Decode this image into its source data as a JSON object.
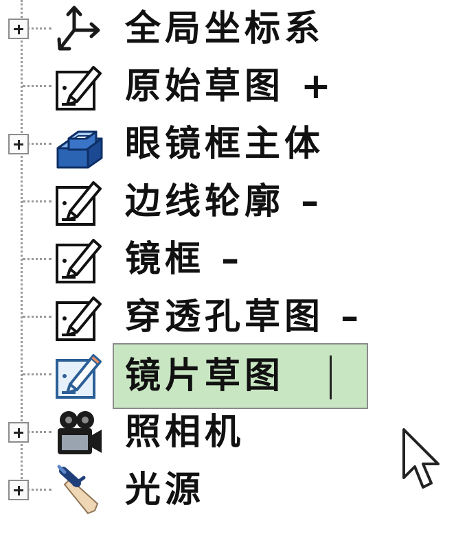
{
  "tree": {
    "items": [
      {
        "label": "全局坐标系",
        "icon": "coordinate-system-icon",
        "expandable": true
      },
      {
        "label": "原始草图 +",
        "icon": "sketch-icon",
        "expandable": false
      },
      {
        "label": "眼镜框主体",
        "icon": "solid-body-icon",
        "expandable": true
      },
      {
        "label": "边线轮廓 –",
        "icon": "sketch-icon",
        "expandable": false
      },
      {
        "label": "镜框 –",
        "icon": "sketch-icon",
        "expandable": false
      },
      {
        "label": "穿透孔草图 –",
        "icon": "sketch-icon",
        "expandable": false
      },
      {
        "label": "镜片草图",
        "icon": "sketch-icon",
        "expandable": false,
        "editing": true
      },
      {
        "label": "照相机",
        "icon": "camera-icon",
        "expandable": true
      },
      {
        "label": "光源",
        "icon": "light-source-icon",
        "expandable": true
      }
    ],
    "rename_highlight": "#c9e6c3"
  }
}
